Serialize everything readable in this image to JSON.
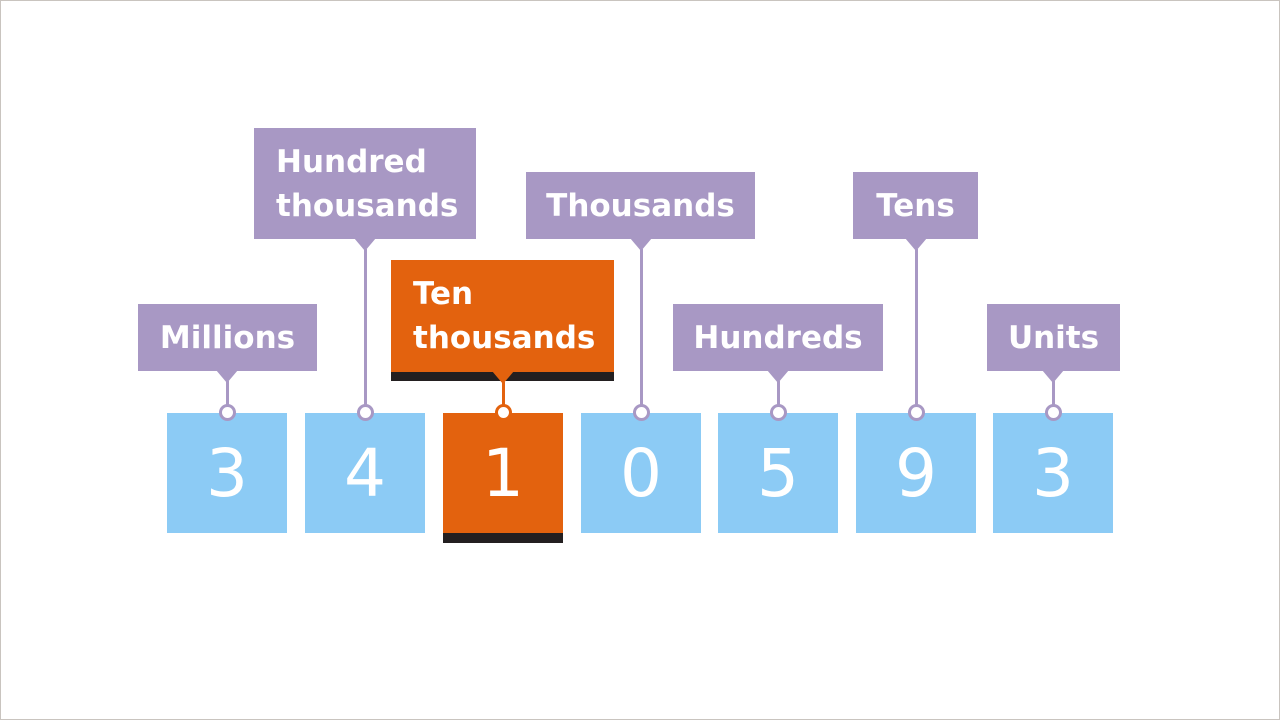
{
  "colors": {
    "label": "#a898c4",
    "digit": "#8ccbf5",
    "highlight": "#e3620e",
    "shadow": "#231f20"
  },
  "places": [
    {
      "label": "Millions",
      "digit": "3"
    },
    {
      "label": "Hundred thousands",
      "line1": "Hundred",
      "line2": "thousands",
      "digit": "4"
    },
    {
      "label": "Ten thousands",
      "line1": "Ten",
      "line2": "thousands",
      "digit": "1",
      "highlighted": true
    },
    {
      "label": "Thousands",
      "digit": "0"
    },
    {
      "label": "Hundreds",
      "digit": "5"
    },
    {
      "label": "Tens",
      "digit": "9"
    },
    {
      "label": "Units",
      "digit": "3"
    }
  ]
}
